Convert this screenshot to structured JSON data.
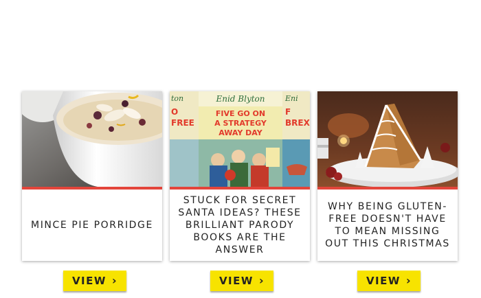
{
  "theme": {
    "accent_red": "#e3453b",
    "button_yellow": "#f7e300",
    "caption_text": "#222222"
  },
  "cards": [
    {
      "title": "MINCE PIE PORRIDGE",
      "image": "porridge-bowl-photo",
      "button_label": "VIEW",
      "button_icon": "chevron-right-icon"
    },
    {
      "title": "STUCK FOR SECRET SANTA IDEAS? THESE BRILLIANT PARODY BOOKS ARE THE ANSWER",
      "image": "parody-book-covers",
      "book": {
        "brand": "Enid Blyton",
        "cover_title": "FIVE GO ON A STRATEGY AWAY DAY",
        "left_cover_fragment": "O FREE",
        "right_cover_fragment": "BREX"
      },
      "button_label": "VIEW",
      "button_icon": "chevron-right-icon"
    },
    {
      "title": "WHY BEING GLUTEN-FREE DOESN'T HAVE TO MEAN MISSING OUT THIS CHRISTMAS",
      "image": "gingerbread-house-photo",
      "button_label": "VIEW",
      "button_icon": "chevron-right-icon"
    }
  ]
}
